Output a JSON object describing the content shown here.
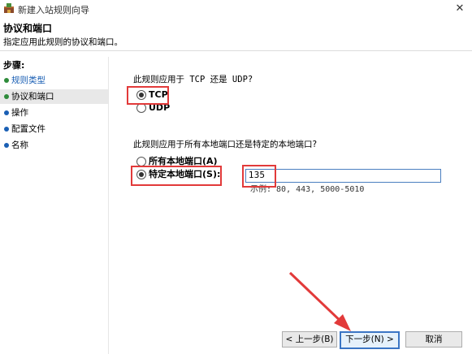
{
  "window": {
    "title": "新建入站规则向导",
    "close_glyph": "✕",
    "icon": "firewall-shield-icon"
  },
  "header": {
    "title": "协议和端口",
    "subtitle": "指定应用此规则的协议和端口。"
  },
  "steps": {
    "label": "步骤:",
    "items": [
      {
        "label": "规则类型",
        "color": "#2e8b3a"
      },
      {
        "label": "协议和端口",
        "color": "#2e8b3a"
      },
      {
        "label": "操作",
        "color": "#1a5fb4"
      },
      {
        "label": "配置文件",
        "color": "#1a5fb4"
      },
      {
        "label": "名称",
        "color": "#1a5fb4"
      }
    ],
    "active_index": 1
  },
  "protocol": {
    "question": "此规则应用于 TCP 还是 UDP?",
    "options": [
      {
        "label": "TCP",
        "checked": true
      },
      {
        "label": "UDP",
        "checked": false
      }
    ]
  },
  "ports": {
    "question": "此规则应用于所有本地端口还是特定的本地端口?",
    "options": [
      {
        "label": "所有本地端口(A)",
        "checked": false
      },
      {
        "label": "特定本地端口(S):",
        "checked": true
      }
    ],
    "value": "135",
    "example": "示例: 80, 443, 5000-5010"
  },
  "buttons": {
    "back": "< 上一步(B)",
    "next": "下一步(N) >",
    "cancel": "取消"
  },
  "annotation_color": "#e23a3a"
}
